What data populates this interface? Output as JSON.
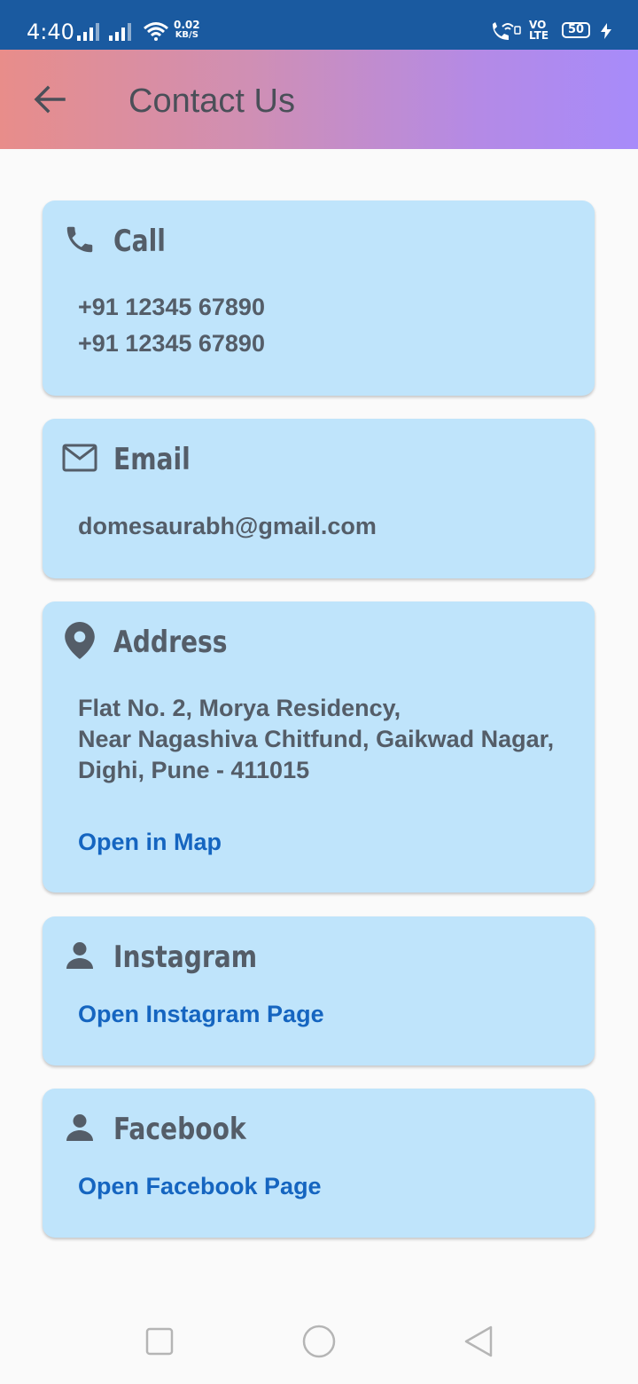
{
  "status_bar": {
    "time": "4:40",
    "net_speed_value": "0.02",
    "net_speed_unit": "KB/S",
    "volte_top": "VO",
    "volte_bottom": "LTE",
    "battery": "50"
  },
  "app_bar": {
    "title": "Contact Us",
    "gradient_start": "#e88d8a",
    "gradient_end": "#a78bfa"
  },
  "cards": {
    "call": {
      "title": "Call",
      "icon": "phone-icon",
      "numbers": [
        "+91 12345 67890",
        "+91 12345 67890"
      ]
    },
    "email": {
      "title": "Email",
      "icon": "mail-icon",
      "address": "domesaurabh@gmail.com"
    },
    "address": {
      "title": "Address",
      "icon": "location-pin-icon",
      "lines": [
        "Flat No. 2, Morya Residency,",
        "Near Nagashiva Chitfund, Gaikwad Nagar,",
        "Dighi, Pune - 411015"
      ],
      "link": "Open in Map"
    },
    "instagram": {
      "title": "Instagram",
      "icon": "person-icon",
      "link": "Open Instagram Page"
    },
    "facebook": {
      "title": "Facebook",
      "icon": "person-icon",
      "link": "Open Facebook Page"
    }
  },
  "colors": {
    "status_bar": "#1a5aa0",
    "card_background": "#bfe4fb",
    "text": "#545d68",
    "link": "#1565c0"
  },
  "nav_bar": {
    "buttons": [
      "recents-square-icon",
      "home-circle-icon",
      "back-triangle-icon"
    ]
  }
}
